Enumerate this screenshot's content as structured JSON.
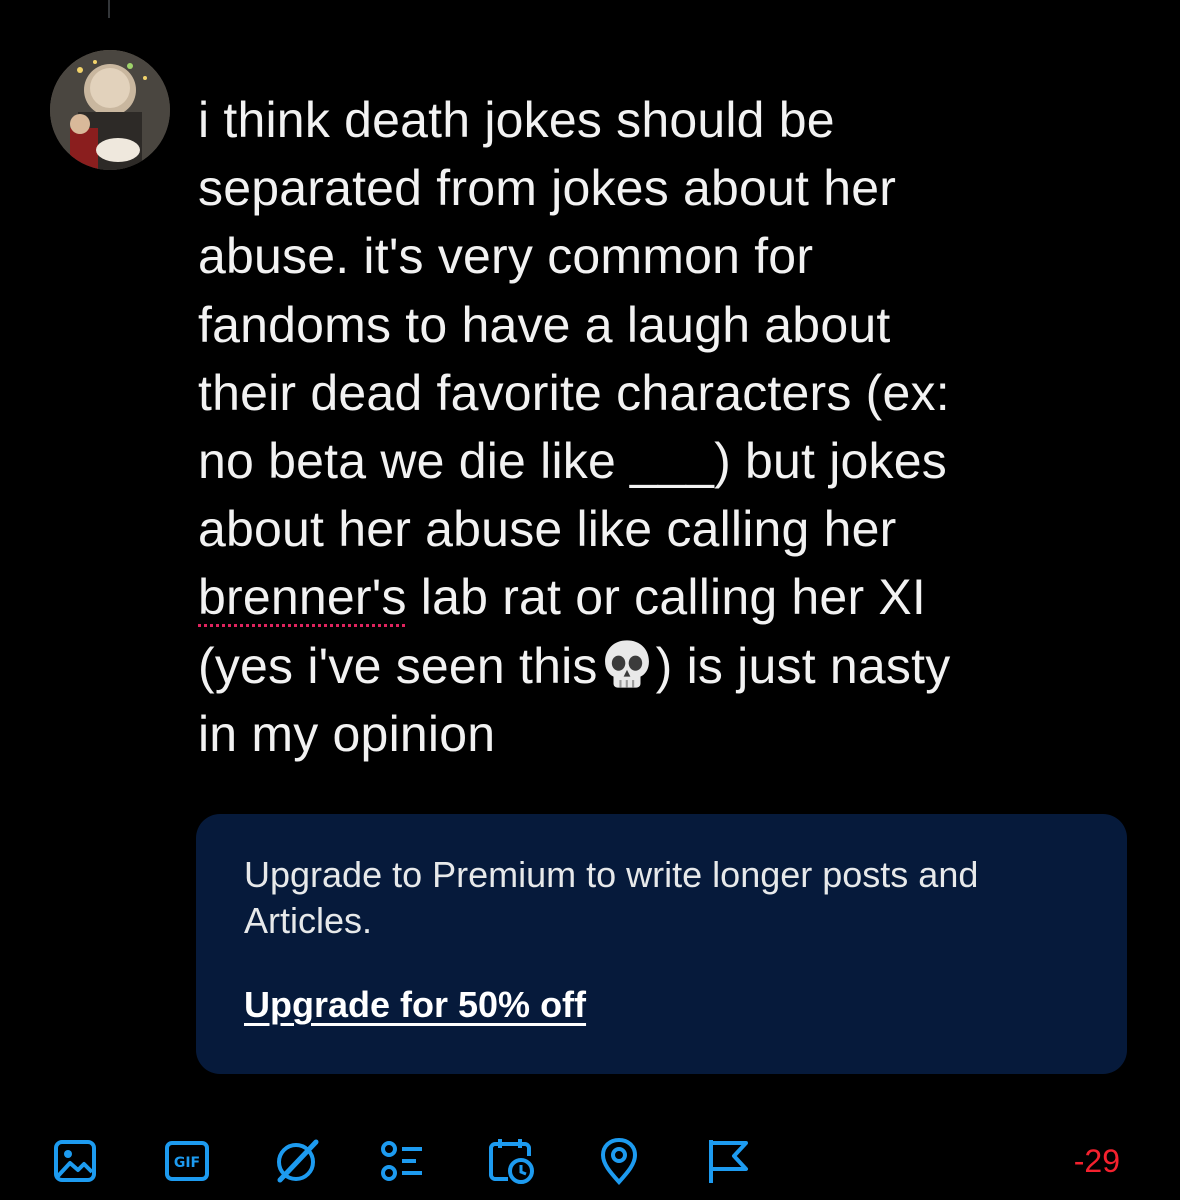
{
  "composer": {
    "text_before_misspelling": "i think death jokes should be\nseparated from jokes about her\nabuse. it's very common for\nfandoms to have a laugh about\ntheir dead favorite characters (ex:\nno beta we die like ___) but jokes\nabout her abuse like calling her\n",
    "misspelled_word": "brenner's",
    "text_after_misspelling": " lab rat or calling her XI\n(yes i've seen this",
    "emoji": "skull-emoji",
    "text_after_emoji": ") is just nasty\nin my opinion"
  },
  "premium_upsell": {
    "message": "Upgrade to Premium to write longer posts and Articles.",
    "link_label": "Upgrade for 50% off",
    "background_color": "#061a3b"
  },
  "toolbar": {
    "icons": [
      "image-icon",
      "gif-icon",
      "grok-icon",
      "poll-icon",
      "schedule-icon",
      "location-icon",
      "flag-icon"
    ],
    "gif_label": "GIF",
    "accent_color": "#1d9bf0"
  },
  "char_counter": {
    "value": "-29",
    "color": "#f4212e"
  }
}
